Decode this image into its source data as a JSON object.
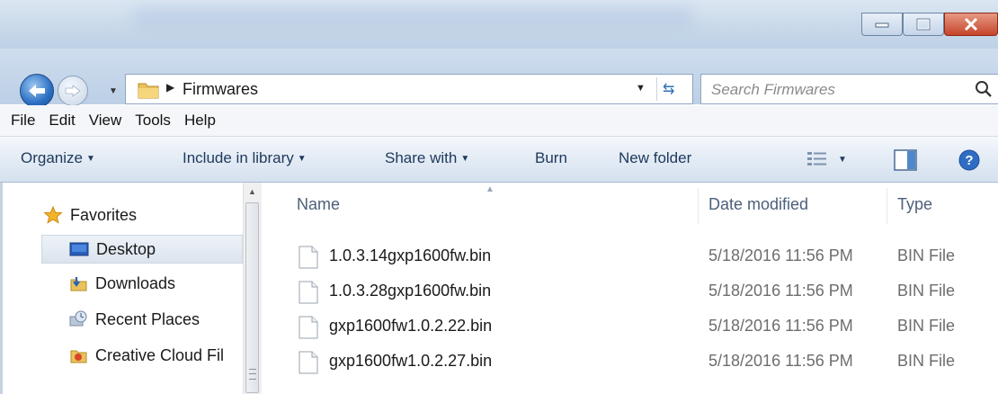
{
  "window": {
    "minimize_icon": "minimize-icon",
    "maximize_icon": "maximize-icon",
    "close_icon": "close-icon"
  },
  "address": {
    "crumb": "Firmwares",
    "search_placeholder": "Search Firmwares"
  },
  "menu": [
    "File",
    "Edit",
    "View",
    "Tools",
    "Help"
  ],
  "toolbar": {
    "organize": "Organize",
    "include_in_library": "Include in library",
    "share_with": "Share with",
    "burn": "Burn",
    "new_folder": "New folder"
  },
  "nav": {
    "favorites": "Favorites",
    "items": [
      {
        "label": "Desktop",
        "icon": "desktop-icon"
      },
      {
        "label": "Downloads",
        "icon": "downloads-icon"
      },
      {
        "label": "Recent Places",
        "icon": "recent-places-icon"
      },
      {
        "label": "Creative Cloud Fil",
        "icon": "creative-cloud-icon"
      }
    ]
  },
  "columns": {
    "name": "Name",
    "date": "Date modified",
    "type": "Type"
  },
  "files": [
    {
      "name": "1.0.3.14gxp1600fw.bin",
      "date": "5/18/2016 11:56 PM",
      "type": "BIN File"
    },
    {
      "name": "1.0.3.28gxp1600fw.bin",
      "date": "5/18/2016 11:56 PM",
      "type": "BIN File"
    },
    {
      "name": "gxp1600fw1.0.2.22.bin",
      "date": "5/18/2016 11:56 PM",
      "type": "BIN File"
    },
    {
      "name": "gxp1600fw1.0.2.27.bin",
      "date": "5/18/2016 11:56 PM",
      "type": "BIN File"
    }
  ],
  "colors": {
    "toolbar_text": "#1e395b",
    "selection": "#dbe4ee",
    "close_button": "#c5442a"
  }
}
